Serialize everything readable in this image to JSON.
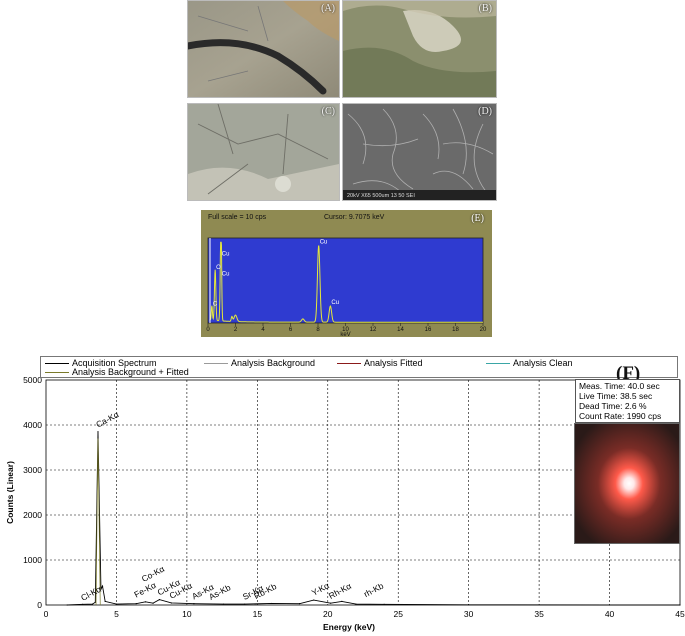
{
  "panels": {
    "a": {
      "label": "(A)"
    },
    "b": {
      "label": "(B)"
    },
    "c": {
      "label": "(C)"
    },
    "d": {
      "label": "(D)",
      "sem_info": "20kV  X65  500um  13 50 SEI"
    }
  },
  "eds": {
    "label": "(E)",
    "full_scale": "Full scale = 10  cps",
    "cursor": "Cursor:  9.7075 keV",
    "x_unit": "keV",
    "x_ticks": [
      "0",
      "2",
      "4",
      "6",
      "8",
      "10",
      "12",
      "14",
      "16",
      "18",
      "20"
    ],
    "xlim": [
      0,
      20
    ],
    "peak_labels": [
      {
        "text": "C",
        "x": 0.28,
        "y": 0.18
      },
      {
        "text": "O",
        "x": 0.52,
        "y": 0.63
      },
      {
        "text": "Cu",
        "x": 0.93,
        "y": 0.55
      },
      {
        "text": "Cu",
        "x": 0.93,
        "y": 0.8
      },
      {
        "text": "Cu",
        "x": 8.05,
        "y": 0.95
      },
      {
        "text": "Cu",
        "x": 8.9,
        "y": 0.2
      }
    ]
  },
  "xrf": {
    "label": "(F)",
    "meas_info": [
      "Meas. Time: 40.0 sec",
      "Live Time: 38.5 sec",
      "Dead Time: 2.6 %",
      "Count Rate: 1990 cps"
    ]
  },
  "chart_data": {
    "type": "line",
    "title": "",
    "xlabel": "Energy (keV)",
    "ylabel": "Counts (Linear)",
    "xlim": [
      0,
      45
    ],
    "ylim": [
      0,
      5000
    ],
    "x_ticks": [
      0,
      5,
      10,
      15,
      20,
      25,
      30,
      35,
      40,
      45
    ],
    "y_ticks": [
      0,
      1000,
      2000,
      3000,
      4000,
      5000
    ],
    "grid": true,
    "legend": [
      {
        "name": "Acquisition Spectrum",
        "color": "#000000"
      },
      {
        "name": "Analysis Background",
        "color": "#9a9a9a"
      },
      {
        "name": "Analysis Fitted",
        "color": "#8b1a1a"
      },
      {
        "name": "Analysis Clean",
        "color": "#3aa6a6"
      },
      {
        "name": "Analysis Background + Fitted",
        "color": "#7a7a2a"
      }
    ],
    "series": [
      {
        "name": "Acquisition Spectrum",
        "x": [
          1.5,
          2.6,
          3.3,
          3.5,
          3.69,
          3.9,
          4.01,
          4.2,
          5.0,
          6.4,
          7.06,
          7.6,
          8.05,
          8.9,
          10.5,
          12.6,
          14.1,
          16.0,
          18.0,
          19.0,
          20.2,
          21.0,
          22.0,
          24.0,
          30.0,
          40.0,
          45.0
        ],
        "y": [
          0,
          15,
          20,
          60,
          3850,
          350,
          420,
          80,
          20,
          30,
          70,
          40,
          120,
          45,
          30,
          20,
          20,
          35,
          30,
          110,
          40,
          80,
          20,
          15,
          5,
          0,
          0
        ]
      }
    ],
    "annotations": [
      "Cl-Kα",
      "Ca-Kα",
      "Co-Kα",
      "Fe-Kα",
      "Cu-Kα",
      "Cu-Kα",
      "As-Kα",
      "As-Kb",
      "Sr-Kα",
      "Rb-Kb",
      "Y-Kα",
      "Rh-Kα",
      "rh-Kb"
    ],
    "annotation_x": [
      2.62,
      3.69,
      6.93,
      6.4,
      8.05,
      8.9,
      10.5,
      11.7,
      14.1,
      14.9,
      19.0,
      20.2,
      22.7
    ],
    "annotation_y": [
      0,
      3850,
      420,
      70,
      120,
      45,
      30,
      20,
      20,
      35,
      110,
      40,
      80
    ]
  },
  "colors": {
    "eds_bg": "#2f3bd0",
    "eds_peak": "#e6e83a",
    "eds_frame": "#8f8a52"
  }
}
